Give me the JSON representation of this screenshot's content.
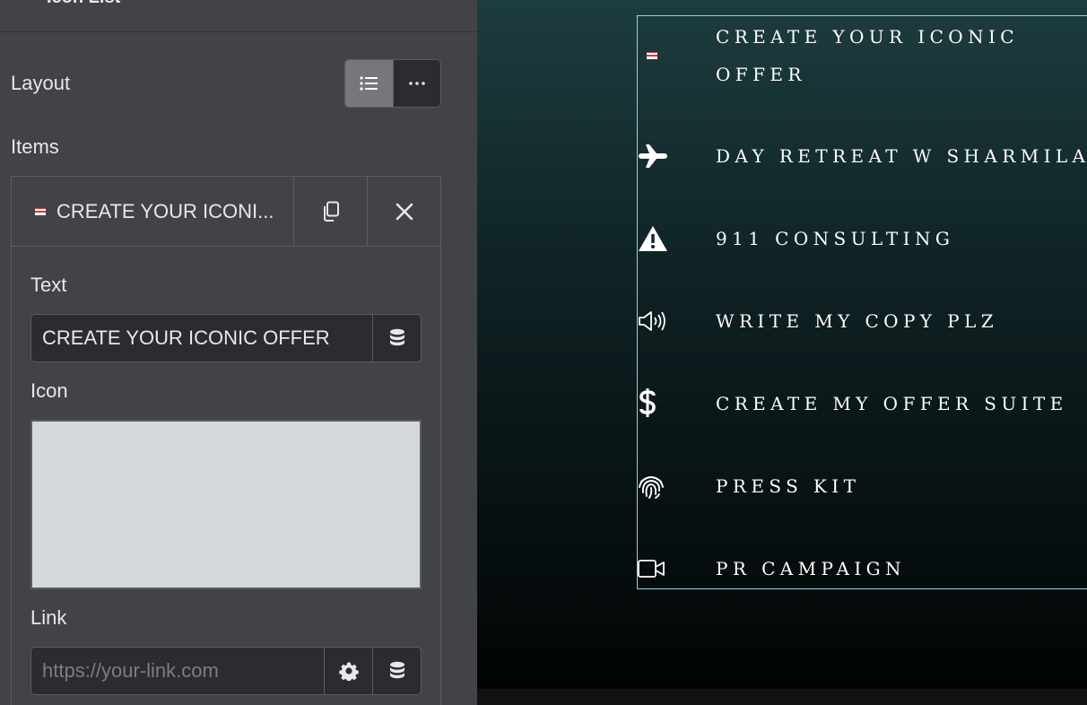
{
  "panel": {
    "title": "Icon List",
    "layout_label": "Layout",
    "layout_options": [
      "list",
      "inline"
    ],
    "layout_selected": "list",
    "items_label": "Items",
    "repeater": {
      "current_item_title": "CREATE YOUR ICONI...",
      "text_label": "Text",
      "text_value": "CREATE YOUR ICONIC OFFER",
      "icon_label": "Icon",
      "link_label": "Link",
      "link_placeholder": "https://your-link.com"
    }
  },
  "preview": {
    "items": [
      {
        "line1": "CREATE YOUR ICONIC",
        "line2": "OFFER",
        "icon": "flag-icon"
      },
      {
        "text": "DAY RETREAT W SHARMILA",
        "icon": "plane-icon"
      },
      {
        "text": "911 CONSULTING",
        "icon": "warning-icon"
      },
      {
        "text": "WRITE MY COPY PLZ",
        "icon": "speaker-icon"
      },
      {
        "text": "CREATE MY OFFER SUITE",
        "icon": "dollar-icon"
      },
      {
        "text": "PRESS KIT",
        "icon": "fingerprint-icon"
      },
      {
        "text": "PR CAMPAIGN",
        "icon": "video-camera-icon"
      }
    ]
  },
  "colors": {
    "panel_bg": "#424346",
    "input_bg": "#2b2c30",
    "selection_outline": "#8ad8e8",
    "preview_gradient_top": "#1d3c3f"
  }
}
